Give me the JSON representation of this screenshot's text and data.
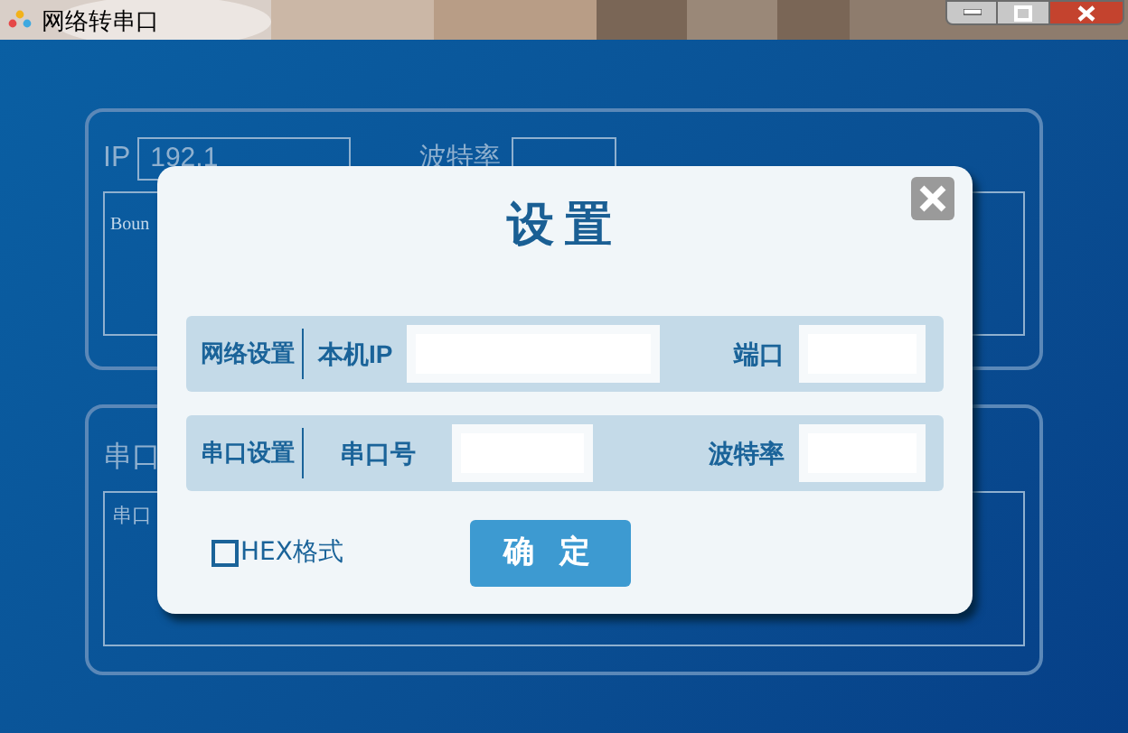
{
  "window": {
    "title": "网络转串口"
  },
  "background_panels": {
    "network": {
      "ip_label": "IP",
      "ip_value": "192.1",
      "baud_label": "波特率",
      "log_text": "Boun"
    },
    "serial": {
      "label": "串口",
      "log_text": "串口"
    }
  },
  "dialog": {
    "title": "设置",
    "sections": [
      {
        "label": "网络设置",
        "fields": [
          {
            "label": "本机IP"
          },
          {
            "label": "端口"
          }
        ]
      },
      {
        "label": "串口设置",
        "fields": [
          {
            "label": "串口号"
          },
          {
            "label": "波特率"
          }
        ]
      }
    ],
    "hex_option": {
      "label": "HEX格式",
      "checked": false
    },
    "confirm_button": "确 定"
  }
}
